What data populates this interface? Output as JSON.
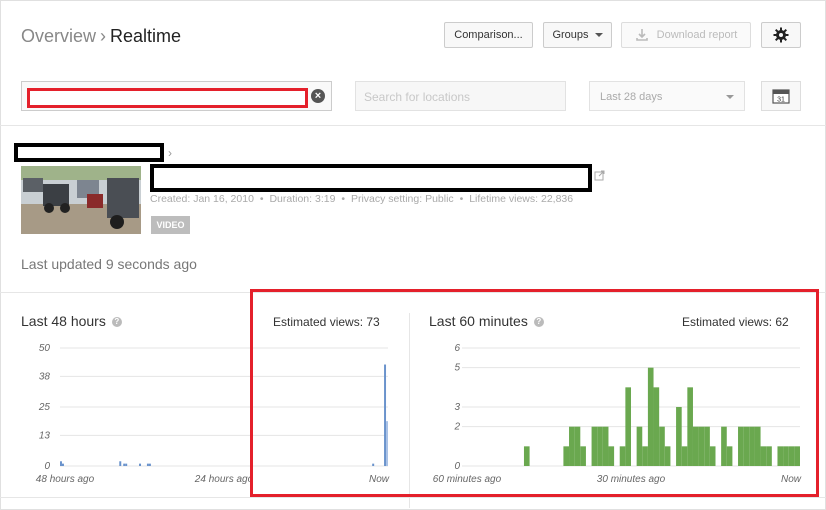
{
  "breadcrumb": {
    "parent": "Overview",
    "separator": "›",
    "current": "Realtime"
  },
  "toolbar": {
    "comparison_label": "Comparison...",
    "groups_label": "Groups",
    "download_label": "Download report"
  },
  "filters": {
    "search_value": "",
    "locations_placeholder": "Search for locations",
    "date_range": "Last 28 days",
    "calendar_day": "31"
  },
  "video": {
    "meta": {
      "created": "Created: Jan 16, 2010",
      "duration": "Duration: 3:19",
      "privacy": "Privacy setting: Public",
      "lifetime": "Lifetime views: 22,836"
    },
    "badge": "VIDEO",
    "separator": "•",
    "crumb_arrow": "›"
  },
  "last_updated": "Last updated 9 seconds ago",
  "panels": {
    "hours": {
      "title": "Last 48 hours",
      "estimated": "Estimated views: 73"
    },
    "minutes": {
      "title": "Last 60 minutes",
      "estimated": "Estimated views: 62"
    }
  },
  "colors": {
    "hours_bar": "#6a93cc",
    "hours_bar_light": "#a9c1e5",
    "minutes_bar": "#6aa84f",
    "highlight": "#e4202b"
  },
  "chart_data": [
    {
      "type": "bar",
      "title": "Last 48 hours",
      "x_tick_labels": [
        "48 hours ago",
        "24 hours ago",
        "Now"
      ],
      "y_ticks": [
        0,
        13,
        25,
        38,
        50
      ],
      "ylim": [
        0,
        50
      ],
      "series": [
        {
          "values": [
            2,
            1,
            0,
            0,
            0,
            0,
            0,
            0,
            0,
            0,
            0,
            0,
            0,
            0,
            0,
            0,
            0,
            0,
            0,
            0,
            0,
            0,
            0,
            0,
            0,
            0,
            0,
            0,
            0,
            0,
            2,
            0,
            1,
            1,
            0,
            0,
            0,
            0,
            0,
            0,
            1,
            0,
            0,
            0,
            1,
            1,
            0,
            0,
            0,
            0,
            0,
            0,
            0,
            0,
            0,
            0,
            0,
            0,
            0,
            0,
            0,
            0,
            0,
            0,
            0,
            0,
            0,
            0,
            0,
            0,
            0,
            0,
            0,
            0,
            0,
            0,
            0,
            0,
            0,
            0,
            0,
            0,
            0,
            0,
            0,
            0,
            0,
            0,
            0,
            0,
            0,
            0,
            0,
            0,
            0,
            0,
            0,
            0,
            0,
            0,
            0,
            0,
            0,
            0,
            0,
            0,
            0,
            0,
            0,
            0,
            0,
            0,
            0,
            0,
            0,
            0,
            0,
            0,
            0,
            0,
            0,
            0,
            0,
            0,
            0,
            0,
            0,
            0,
            0,
            0,
            0,
            0,
            0,
            0,
            0,
            0,
            0,
            0,
            0,
            0,
            0,
            0,
            0,
            0,
            0,
            0,
            0,
            0,
            0,
            0,
            0,
            0,
            0,
            0,
            0,
            0,
            0,
            0,
            1,
            0,
            0,
            0,
            0,
            0,
            43,
            19
          ]
        }
      ],
      "notes": "Last bar shows current partial hour in lighter shade"
    },
    {
      "type": "bar",
      "title": "Last 60 minutes",
      "x_tick_labels": [
        "60 minutes ago",
        "30 minutes ago",
        "Now"
      ],
      "y_ticks": [
        0,
        2,
        3,
        5,
        6
      ],
      "ylim": [
        0,
        6
      ],
      "series": [
        {
          "values": [
            0,
            0,
            0,
            0,
            0,
            0,
            0,
            0,
            0,
            0,
            0,
            1,
            0,
            0,
            0,
            0,
            0,
            0,
            1,
            2,
            2,
            1,
            0,
            2,
            2,
            2,
            1,
            0,
            1,
            4,
            0,
            2,
            1,
            5,
            4,
            2,
            1,
            0,
            3,
            1,
            4,
            2,
            2,
            2,
            1,
            0,
            2,
            1,
            0,
            2,
            2,
            2,
            2,
            1,
            1,
            0,
            1,
            1,
            1,
            1
          ]
        }
      ]
    }
  ]
}
